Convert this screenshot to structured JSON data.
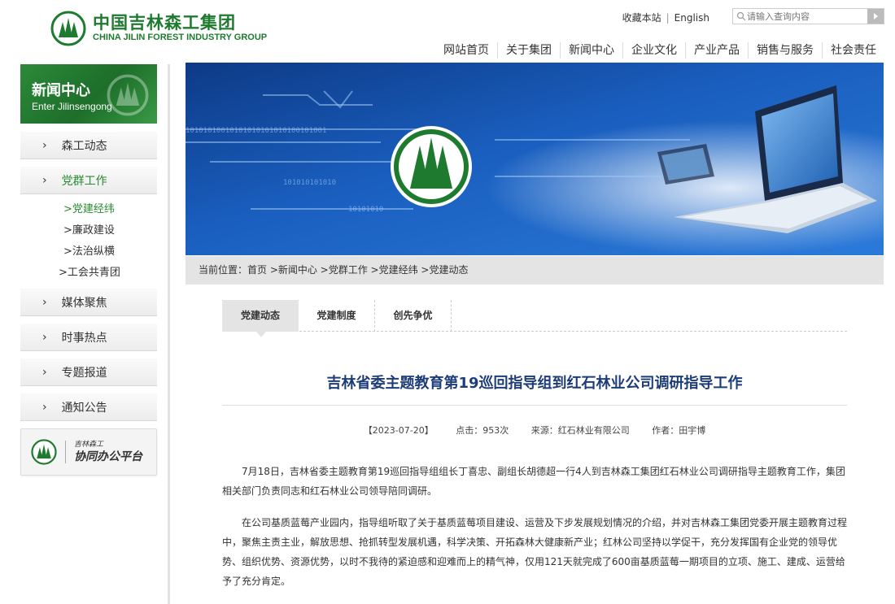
{
  "header": {
    "logo_cn": "中国吉林森工集团",
    "logo_en": "CHINA JILIN FOREST INDUSTRY GROUP",
    "favorite_label": "收藏本站",
    "english_label": "English",
    "search_placeholder": "请输入查询内容"
  },
  "nav": {
    "items": [
      "网站首页",
      "关于集团",
      "新闻中心",
      "企业文化",
      "产业产品",
      "销售与服务",
      "社会责任"
    ]
  },
  "sidebar": {
    "title": "新闻中心",
    "subtitle": "Enter Jilinsengong",
    "items": [
      "森工动态",
      "党群工作",
      "媒体聚焦",
      "时事热点",
      "专题报道",
      "通知公告"
    ],
    "subitems": [
      ">党建经纬",
      ">廉政建设",
      ">法治纵横",
      ">工会共青团"
    ],
    "platform_small": "吉林森工",
    "platform_big": "协同办公平台"
  },
  "breadcrumb": "当前位置：首页 >新闻中心 >党群工作 >党建经纬 >党建动态",
  "tabs": [
    "党建动态",
    "党建制度",
    "创先争优"
  ],
  "article": {
    "title": "吉林省委主题教育第19巡回指导组到红石林业公司调研指导工作",
    "date": "【2023-07-20】",
    "clicks": "点击：953次",
    "source": "来源：红石林业有限公司",
    "author": "作者：田宇博",
    "paragraphs": [
      "7月18日，吉林省委主题教育第19巡回指导组组长丁喜忠、副组长胡德超一行4人到吉林森工集团红石林业公司调研指导主题教育工作，集团相关部门负责同志和红石林业公司领导陪同调研。",
      "在公司基质蓝莓产业园内，指导组听取了关于基质蓝莓项目建设、运营及下步发展规划情况的介绍，并对吉林森工集团党委开展主题教育过程中，聚焦主责主业，解放思想、抢抓转型发展机遇，科学决策、开拓森林大健康新产业；红林公司坚持以学促干，充分发挥国有企业党的领导优势、组织优势、资源优势，以时不我待的紧迫感和迎难而上的精气神，仅用121天就完成了600亩基质蓝莓一期项目的立项、施工、建成、运营给予了充分肯定。"
    ]
  },
  "colors": {
    "brand_green": "#1e7a2e",
    "title_blue": "#1d3d7a",
    "active_green": "#2a8a32"
  }
}
